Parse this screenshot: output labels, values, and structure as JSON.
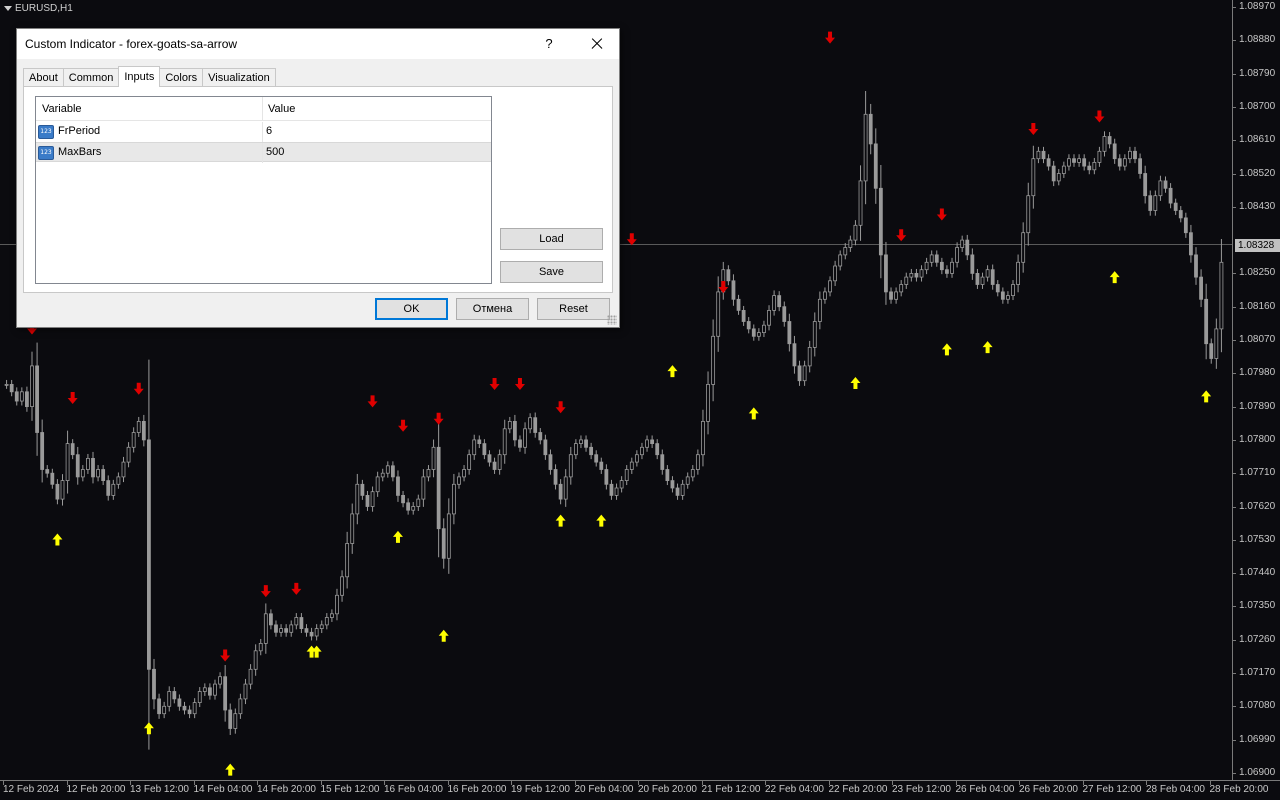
{
  "chart": {
    "symbol_label": "EURUSD,H1",
    "current_price": "1.08328",
    "price_levels": [
      "1.08970",
      "1.08880",
      "1.08790",
      "1.08700",
      "1.08610",
      "1.08520",
      "1.08430",
      "1.08250",
      "1.08160",
      "1.08070",
      "1.07980",
      "1.07890",
      "1.07800",
      "1.07710",
      "1.07620",
      "1.07530",
      "1.07440",
      "1.07350",
      "1.07260",
      "1.07170",
      "1.07080",
      "1.06990",
      "1.06900"
    ],
    "time_labels": [
      "12 Feb 2024",
      "12 Feb 20:00",
      "13 Feb 12:00",
      "14 Feb 04:00",
      "14 Feb 20:00",
      "15 Feb 12:00",
      "16 Feb 04:00",
      "16 Feb 20:00",
      "19 Feb 12:00",
      "20 Feb 04:00",
      "20 Feb 20:00",
      "21 Feb 12:00",
      "22 Feb 04:00",
      "22 Feb 20:00",
      "23 Feb 12:00",
      "26 Feb 04:00",
      "26 Feb 20:00",
      "27 Feb 12:00",
      "28 Feb 04:00",
      "28 Feb 20:00"
    ],
    "colors": {
      "background": "#0b0b0f",
      "candle": "#9a9a9a",
      "down_arrow": "#e00000",
      "up_arrow": "#ffff00",
      "axis_text": "#c8c8c8"
    },
    "close_path": [
      [
        "12 Feb 00:00",
        1.0795
      ],
      [
        "12 Feb 01:00",
        1.0793
      ],
      [
        "12 Feb 02:00",
        1.07905
      ],
      [
        "12 Feb 03:00",
        1.0793
      ],
      [
        "12 Feb 04:00",
        1.0789
      ],
      [
        "12 Feb 05:00",
        1.08
      ],
      [
        "12 Feb 06:00",
        1.0782
      ],
      [
        "12 Feb 07:00",
        1.0772
      ],
      [
        "12 Feb 08:00",
        1.0771
      ],
      [
        "12 Feb 09:00",
        1.0768
      ],
      [
        "12 Feb 10:00",
        1.0764
      ],
      [
        "12 Feb 11:00",
        1.0769
      ],
      [
        "12 Feb 12:00",
        1.0779
      ],
      [
        "12 Feb 13:00",
        1.0776
      ],
      [
        "12 Feb 14:00",
        1.077
      ],
      [
        "12 Feb 15:00",
        1.0772
      ],
      [
        "12 Feb 16:00",
        1.0775
      ],
      [
        "12 Feb 17:00",
        1.077
      ],
      [
        "12 Feb 18:00",
        1.0772
      ],
      [
        "12 Feb 19:00",
        1.0769
      ],
      [
        "12 Feb 20:00",
        1.0765
      ],
      [
        "12 Feb 21:00",
        1.0768
      ],
      [
        "12 Feb 22:00",
        1.077
      ],
      [
        "12 Feb 23:00",
        1.0774
      ],
      [
        "13 Feb 00:00",
        1.0778
      ],
      [
        "13 Feb 01:00",
        1.0782
      ],
      [
        "13 Feb 02:00",
        1.0785
      ],
      [
        "13 Feb 03:00",
        1.078
      ],
      [
        "13 Feb 04:00",
        1.0718
      ],
      [
        "13 Feb 05:00",
        1.071
      ],
      [
        "13 Feb 06:00",
        1.0706
      ],
      [
        "13 Feb 07:00",
        1.0708
      ],
      [
        "13 Feb 08:00",
        1.0712
      ],
      [
        "13 Feb 09:00",
        1.071
      ],
      [
        "13 Feb 10:00",
        1.0708
      ],
      [
        "13 Feb 11:00",
        1.0707
      ],
      [
        "13 Feb 12:00",
        1.0706
      ],
      [
        "13 Feb 13:00",
        1.0709
      ],
      [
        "13 Feb 14:00",
        1.0712
      ],
      [
        "13 Feb 15:00",
        1.0713
      ],
      [
        "13 Feb 16:00",
        1.0711
      ],
      [
        "13 Feb 17:00",
        1.0714
      ],
      [
        "13 Feb 18:00",
        1.0716
      ],
      [
        "13 Feb 19:00",
        1.0707
      ],
      [
        "13 Feb 20:00",
        1.0702
      ],
      [
        "13 Feb 21:00",
        1.0706
      ],
      [
        "13 Feb 22:00",
        1.071
      ],
      [
        "13 Feb 23:00",
        1.0714
      ],
      [
        "14 Feb 00:00",
        1.0718
      ],
      [
        "14 Feb 01:00",
        1.0723
      ],
      [
        "14 Feb 02:00",
        1.0725
      ],
      [
        "14 Feb 03:00",
        1.0733
      ],
      [
        "14 Feb 04:00",
        1.073
      ],
      [
        "14 Feb 05:00",
        1.0728
      ],
      [
        "14 Feb 06:00",
        1.0729
      ],
      [
        "14 Feb 07:00",
        1.0728
      ],
      [
        "14 Feb 08:00",
        1.073
      ],
      [
        "14 Feb 09:00",
        1.0732
      ],
      [
        "14 Feb 10:00",
        1.0729
      ],
      [
        "14 Feb 11:00",
        1.0728
      ],
      [
        "14 Feb 12:00",
        1.0727
      ],
      [
        "14 Feb 13:00",
        1.0729
      ],
      [
        "14 Feb 14:00",
        1.073
      ],
      [
        "14 Feb 15:00",
        1.0732
      ],
      [
        "14 Feb 16:00",
        1.0733
      ],
      [
        "14 Feb 17:00",
        1.0738
      ],
      [
        "14 Feb 18:00",
        1.0743
      ],
      [
        "14 Feb 19:00",
        1.0752
      ],
      [
        "14 Feb 20:00",
        1.076
      ],
      [
        "14 Feb 21:00",
        1.0768
      ],
      [
        "14 Feb 22:00",
        1.0765
      ],
      [
        "14 Feb 23:00",
        1.0762
      ],
      [
        "15 Feb 00:00",
        1.0766
      ],
      [
        "15 Feb 01:00",
        1.077
      ],
      [
        "15 Feb 02:00",
        1.0771
      ],
      [
        "15 Feb 03:00",
        1.0773
      ],
      [
        "15 Feb 04:00",
        1.077
      ],
      [
        "15 Feb 05:00",
        1.0765
      ],
      [
        "15 Feb 06:00",
        1.0763
      ],
      [
        "15 Feb 07:00",
        1.0761
      ],
      [
        "15 Feb 08:00",
        1.0762
      ],
      [
        "15 Feb 09:00",
        1.0764
      ],
      [
        "15 Feb 10:00",
        1.077
      ],
      [
        "15 Feb 11:00",
        1.0772
      ],
      [
        "15 Feb 12:00",
        1.0778
      ],
      [
        "15 Feb 13:00",
        1.0756
      ],
      [
        "15 Feb 14:00",
        1.0748
      ],
      [
        "15 Feb 15:00",
        1.076
      ],
      [
        "15 Feb 16:00",
        1.0768
      ],
      [
        "15 Feb 17:00",
        1.077
      ],
      [
        "15 Feb 18:00",
        1.0772
      ],
      [
        "15 Feb 19:00",
        1.0776
      ],
      [
        "15 Feb 20:00",
        1.078
      ],
      [
        "15 Feb 21:00",
        1.0779
      ],
      [
        "15 Feb 22:00",
        1.0776
      ],
      [
        "15 Feb 23:00",
        1.0774
      ],
      [
        "16 Feb 00:00",
        1.0772
      ],
      [
        "16 Feb 01:00",
        1.0776
      ],
      [
        "16 Feb 02:00",
        1.0783
      ],
      [
        "16 Feb 03:00",
        1.0785
      ],
      [
        "16 Feb 04:00",
        1.078
      ],
      [
        "16 Feb 05:00",
        1.0778
      ],
      [
        "16 Feb 06:00",
        1.0783
      ],
      [
        "16 Feb 07:00",
        1.0786
      ],
      [
        "16 Feb 08:00",
        1.0782
      ],
      [
        "16 Feb 09:00",
        1.078
      ],
      [
        "16 Feb 10:00",
        1.0776
      ],
      [
        "16 Feb 11:00",
        1.0772
      ],
      [
        "16 Feb 12:00",
        1.0768
      ],
      [
        "16 Feb 13:00",
        1.0764
      ],
      [
        "16 Feb 14:00",
        1.077
      ],
      [
        "16 Feb 15:00",
        1.0776
      ],
      [
        "16 Feb 16:00",
        1.0779
      ],
      [
        "16 Feb 17:00",
        1.078
      ],
      [
        "16 Feb 18:00",
        1.0778
      ],
      [
        "16 Feb 19:00",
        1.0776
      ],
      [
        "16 Feb 20:00",
        1.0774
      ],
      [
        "16 Feb 21:00",
        1.0772
      ],
      [
        "16 Feb 22:00",
        1.0768
      ],
      [
        "16 Feb 23:00",
        1.0765
      ],
      [
        "19 Feb 00:00",
        1.0767
      ],
      [
        "19 Feb 01:00",
        1.0769
      ],
      [
        "19 Feb 02:00",
        1.0772
      ],
      [
        "19 Feb 03:00",
        1.0774
      ],
      [
        "19 Feb 04:00",
        1.0776
      ],
      [
        "19 Feb 05:00",
        1.0778
      ],
      [
        "19 Feb 06:00",
        1.078
      ],
      [
        "19 Feb 07:00",
        1.0779
      ],
      [
        "19 Feb 08:00",
        1.0776
      ],
      [
        "19 Feb 09:00",
        1.0772
      ],
      [
        "19 Feb 10:00",
        1.0769
      ],
      [
        "19 Feb 11:00",
        1.0767
      ],
      [
        "19 Feb 12:00",
        1.0765
      ],
      [
        "19 Feb 13:00",
        1.0768
      ],
      [
        "19 Feb 14:00",
        1.077
      ],
      [
        "19 Feb 15:00",
        1.0772
      ],
      [
        "19 Feb 16:00",
        1.0776
      ],
      [
        "19 Feb 17:00",
        1.0785
      ],
      [
        "19 Feb 18:00",
        1.0795
      ],
      [
        "19 Feb 19:00",
        1.0808
      ],
      [
        "19 Feb 20:00",
        1.082
      ],
      [
        "19 Feb 21:00",
        1.0826
      ],
      [
        "19 Feb 22:00",
        1.0823
      ],
      [
        "19 Feb 23:00",
        1.0818
      ],
      [
        "20 Feb 00:00",
        1.0815
      ],
      [
        "20 Feb 01:00",
        1.0812
      ],
      [
        "20 Feb 02:00",
        1.081
      ],
      [
        "20 Feb 03:00",
        1.0808
      ],
      [
        "20 Feb 04:00",
        1.0809
      ],
      [
        "20 Feb 05:00",
        1.0811
      ],
      [
        "20 Feb 06:00",
        1.0815
      ],
      [
        "20 Feb 07:00",
        1.0819
      ],
      [
        "20 Feb 08:00",
        1.0816
      ],
      [
        "20 Feb 09:00",
        1.0812
      ],
      [
        "20 Feb 10:00",
        1.0806
      ],
      [
        "20 Feb 11:00",
        1.08
      ],
      [
        "20 Feb 12:00",
        1.0796
      ],
      [
        "20 Feb 13:00",
        1.08
      ],
      [
        "20 Feb 14:00",
        1.0805
      ],
      [
        "20 Feb 15:00",
        1.0812
      ],
      [
        "20 Feb 16:00",
        1.0818
      ],
      [
        "20 Feb 17:00",
        1.082
      ],
      [
        "20 Feb 18:00",
        1.0823
      ],
      [
        "20 Feb 19:00",
        1.0827
      ],
      [
        "20 Feb 20:00",
        1.083
      ],
      [
        "20 Feb 21:00",
        1.0832
      ],
      [
        "20 Feb 22:00",
        1.0834
      ],
      [
        "20 Feb 23:00",
        1.0838
      ],
      [
        "21 Feb 00:00",
        1.085
      ],
      [
        "21 Feb 01:00",
        1.0868
      ],
      [
        "21 Feb 02:00",
        1.086
      ],
      [
        "21 Feb 03:00",
        1.0848
      ],
      [
        "21 Feb 04:00",
        1.083
      ],
      [
        "21 Feb 05:00",
        1.082
      ],
      [
        "21 Feb 06:00",
        1.0818
      ],
      [
        "21 Feb 07:00",
        1.082
      ],
      [
        "21 Feb 08:00",
        1.0822
      ],
      [
        "21 Feb 09:00",
        1.0824
      ],
      [
        "21 Feb 10:00",
        1.0825
      ],
      [
        "21 Feb 11:00",
        1.0824
      ],
      [
        "21 Feb 12:00",
        1.0826
      ],
      [
        "21 Feb 13:00",
        1.0828
      ],
      [
        "21 Feb 14:00",
        1.083
      ],
      [
        "21 Feb 15:00",
        1.0828
      ],
      [
        "21 Feb 16:00",
        1.0826
      ],
      [
        "21 Feb 17:00",
        1.0825
      ],
      [
        "21 Feb 18:00",
        1.0828
      ],
      [
        "21 Feb 19:00",
        1.0832
      ],
      [
        "21 Feb 20:00",
        1.0834
      ],
      [
        "21 Feb 21:00",
        1.083
      ],
      [
        "21 Feb 22:00",
        1.0825
      ],
      [
        "21 Feb 23:00",
        1.0822
      ],
      [
        "22 Feb 00:00",
        1.0824
      ],
      [
        "22 Feb 01:00",
        1.0826
      ],
      [
        "22 Feb 02:00",
        1.0822
      ],
      [
        "22 Feb 03:00",
        1.082
      ],
      [
        "22 Feb 04:00",
        1.0818
      ],
      [
        "22 Feb 05:00",
        1.0819
      ],
      [
        "22 Feb 06:00",
        1.0822
      ],
      [
        "22 Feb 07:00",
        1.0828
      ],
      [
        "22 Feb 08:00",
        1.0836
      ],
      [
        "22 Feb 09:00",
        1.0846
      ],
      [
        "22 Feb 10:00",
        1.0856
      ],
      [
        "22 Feb 11:00",
        1.0858
      ],
      [
        "22 Feb 12:00",
        1.0856
      ],
      [
        "22 Feb 13:00",
        1.0854
      ],
      [
        "22 Feb 14:00",
        1.085
      ],
      [
        "22 Feb 15:00",
        1.0852
      ],
      [
        "22 Feb 16:00",
        1.0854
      ],
      [
        "22 Feb 17:00",
        1.0856
      ],
      [
        "22 Feb 18:00",
        1.0855
      ],
      [
        "22 Feb 19:00",
        1.0856
      ],
      [
        "22 Feb 20:00",
        1.0854
      ],
      [
        "22 Feb 21:00",
        1.0853
      ],
      [
        "22 Feb 22:00",
        1.0855
      ],
      [
        "22 Feb 23:00",
        1.0858
      ],
      [
        "23 Feb 00:00",
        1.0862
      ],
      [
        "23 Feb 01:00",
        1.086
      ],
      [
        "23 Feb 02:00",
        1.0856
      ],
      [
        "23 Feb 03:00",
        1.0854
      ],
      [
        "23 Feb 04:00",
        1.0856
      ],
      [
        "23 Feb 05:00",
        1.0858
      ],
      [
        "23 Feb 06:00",
        1.0856
      ],
      [
        "23 Feb 07:00",
        1.0852
      ],
      [
        "23 Feb 08:00",
        1.0846
      ],
      [
        "23 Feb 09:00",
        1.0842
      ],
      [
        "23 Feb 10:00",
        1.0846
      ],
      [
        "23 Feb 11:00",
        1.085
      ],
      [
        "23 Feb 12:00",
        1.0848
      ],
      [
        "23 Feb 13:00",
        1.0844
      ],
      [
        "23 Feb 14:00",
        1.0842
      ],
      [
        "23 Feb 15:00",
        1.084
      ],
      [
        "23 Feb 16:00",
        1.0836
      ],
      [
        "23 Feb 17:00",
        1.083
      ],
      [
        "23 Feb 18:00",
        1.0824
      ],
      [
        "23 Feb 19:00",
        1.0818
      ],
      [
        "23 Feb 20:00",
        1.0806
      ],
      [
        "23 Feb 21:00",
        1.0802
      ],
      [
        "23 Feb 22:00",
        1.081
      ],
      [
        "23 Feb 23:00",
        1.0828
      ]
    ],
    "signals": [
      {
        "type": "down",
        "time": "12 Feb 05:00",
        "price": 1.08085
      },
      {
        "type": "down",
        "time": "12 Feb 13:00",
        "price": 1.07897
      },
      {
        "type": "up",
        "time": "12 Feb 10:00",
        "price": 1.07547
      },
      {
        "type": "down",
        "time": "13 Feb 02:00",
        "price": 1.07922
      },
      {
        "type": "up",
        "time": "13 Feb 04:00",
        "price": 1.07037
      },
      {
        "type": "down",
        "time": "13 Feb 19:00",
        "price": 1.07201
      },
      {
        "type": "up",
        "time": "13 Feb 20:00",
        "price": 1.06925
      },
      {
        "type": "down",
        "time": "14 Feb 03:00",
        "price": 1.07375
      },
      {
        "type": "down",
        "time": "14 Feb 09:00",
        "price": 1.07381
      },
      {
        "type": "up",
        "time": "14 Feb 12:00",
        "price": 1.07244
      },
      {
        "type": "up",
        "time": "14 Feb 13:00",
        "price": 1.07244
      },
      {
        "type": "down",
        "time": "15 Feb 00:00",
        "price": 1.07888
      },
      {
        "type": "down",
        "time": "15 Feb 06:00",
        "price": 1.07822
      },
      {
        "type": "up",
        "time": "15 Feb 05:00",
        "price": 1.07554
      },
      {
        "type": "down",
        "time": "15 Feb 13:00",
        "price": 1.07841
      },
      {
        "type": "up",
        "time": "15 Feb 14:00",
        "price": 1.07287
      },
      {
        "type": "down",
        "time": "16 Feb 00:00",
        "price": 1.07935
      },
      {
        "type": "down",
        "time": "16 Feb 05:00",
        "price": 1.07935
      },
      {
        "type": "down",
        "time": "16 Feb 13:00",
        "price": 1.07872
      },
      {
        "type": "up",
        "time": "16 Feb 13:00",
        "price": 1.07598
      },
      {
        "type": "up",
        "time": "16 Feb 21:00",
        "price": 1.07598
      },
      {
        "type": "down",
        "time": "19 Feb 03:00",
        "price": 1.08326
      },
      {
        "type": "up",
        "time": "19 Feb 11:00",
        "price": 1.08002
      },
      {
        "type": "down",
        "time": "19 Feb 21:00",
        "price": 1.08197
      },
      {
        "type": "up",
        "time": "20 Feb 03:00",
        "price": 1.07888
      },
      {
        "type": "down",
        "time": "20 Feb 18:00",
        "price": 1.08871
      },
      {
        "type": "up",
        "time": "20 Feb 23:00",
        "price": 1.0797
      },
      {
        "type": "down",
        "time": "21 Feb 08:00",
        "price": 1.08337
      },
      {
        "type": "down",
        "time": "21 Feb 16:00",
        "price": 1.08393
      },
      {
        "type": "up",
        "time": "21 Feb 17:00",
        "price": 1.08061
      },
      {
        "type": "up",
        "time": "22 Feb 01:00",
        "price": 1.08067
      },
      {
        "type": "down",
        "time": "22 Feb 10:00",
        "price": 1.08624
      },
      {
        "type": "down",
        "time": "22 Feb 23:00",
        "price": 1.08658
      },
      {
        "type": "up",
        "time": "23 Feb 02:00",
        "price": 1.08256
      },
      {
        "type": "up",
        "time": "23 Feb 20:00",
        "price": 1.07934
      }
    ]
  },
  "dialog": {
    "title": "Custom Indicator - forex-goats-sa-arrow",
    "help": "?",
    "tabs": [
      {
        "label": "About",
        "active": false
      },
      {
        "label": "Common",
        "active": false
      },
      {
        "label": "Inputs",
        "active": true
      },
      {
        "label": "Colors",
        "active": false
      },
      {
        "label": "Visualization",
        "active": false
      }
    ],
    "grid": {
      "col_variable": "Variable",
      "col_value": "Value",
      "rows": [
        {
          "variable": "FrPeriod",
          "value": "6",
          "icon": "123-icon",
          "icon_text": "123"
        },
        {
          "variable": "MaxBars",
          "value": "500",
          "icon": "123-icon",
          "icon_text": "123"
        }
      ]
    },
    "load_label": "Load",
    "save_label": "Save",
    "ok_label": "OK",
    "cancel_label": "Отмена",
    "reset_label": "Reset"
  }
}
